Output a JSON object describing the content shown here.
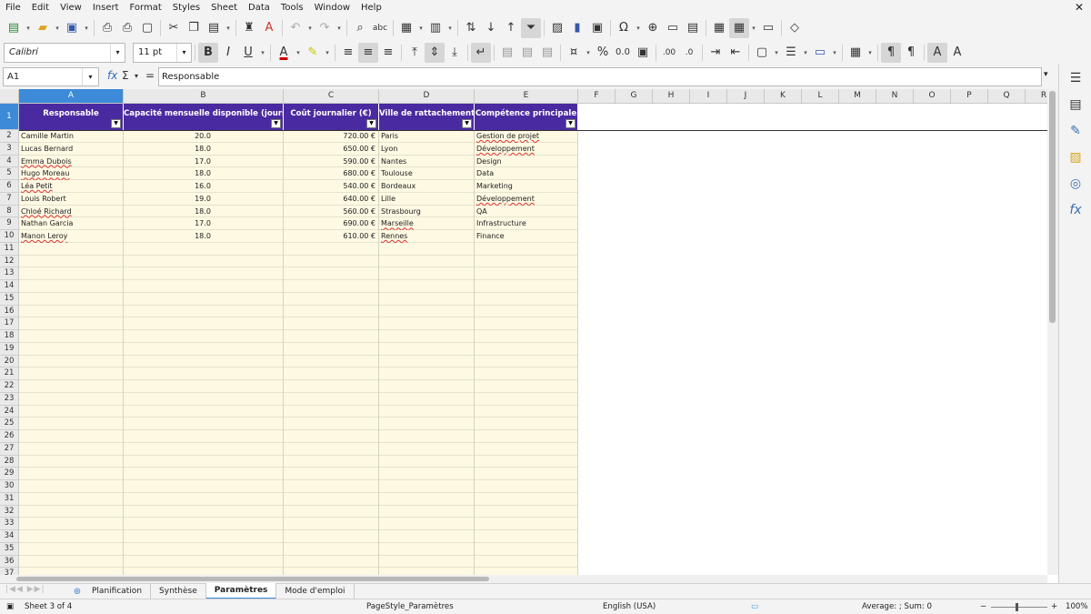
{
  "menu": [
    "File",
    "Edit",
    "View",
    "Insert",
    "Format",
    "Styles",
    "Sheet",
    "Data",
    "Tools",
    "Window",
    "Help"
  ],
  "toolbar": {
    "font_name": "Calibri",
    "font_size": "11 pt"
  },
  "formula_bar": {
    "cell_ref": "A1",
    "content": "Responsable"
  },
  "columns": [
    "A",
    "B",
    "C",
    "D",
    "E",
    "F",
    "G",
    "H",
    "I",
    "J",
    "K",
    "L",
    "M",
    "N",
    "O",
    "P",
    "Q",
    "R"
  ],
  "headers": [
    "Responsable",
    "Capacité mensuelle disponible (jours)",
    "Coût journalier (€)",
    "Ville de rattachement",
    "Compétence principale"
  ],
  "rows": [
    {
      "name": "Camille Martin",
      "capacity": "20.0",
      "cost": "720.00 €",
      "city": "Paris",
      "skill": "Gestion de projet"
    },
    {
      "name": "Lucas Bernard",
      "capacity": "18.0",
      "cost": "650.00 €",
      "city": "Lyon",
      "skill": "Développement"
    },
    {
      "name": "Emma Dubois",
      "capacity": "17.0",
      "cost": "590.00 €",
      "city": "Nantes",
      "skill": "Design"
    },
    {
      "name": "Hugo Moreau",
      "capacity": "18.0",
      "cost": "680.00 €",
      "city": "Toulouse",
      "skill": "Data"
    },
    {
      "name": "Léa Petit",
      "capacity": "16.0",
      "cost": "540.00 €",
      "city": "Bordeaux",
      "skill": "Marketing"
    },
    {
      "name": "Louis Robert",
      "capacity": "19.0",
      "cost": "640.00 €",
      "city": "Lille",
      "skill": "Développement"
    },
    {
      "name": "Chloé Richard",
      "capacity": "18.0",
      "cost": "560.00 €",
      "city": "Strasbourg",
      "skill": "QA"
    },
    {
      "name": "Nathan Garcia",
      "capacity": "17.0",
      "cost": "690.00 €",
      "city": "Marseille",
      "skill": "Infrastructure"
    },
    {
      "name": "Manon Leroy",
      "capacity": "18.0",
      "cost": "610.00 €",
      "city": "Rennes",
      "skill": "Finance"
    }
  ],
  "row_numbers": [
    "1",
    "2",
    "3",
    "4",
    "5",
    "6",
    "7",
    "8",
    "9",
    "10",
    "11",
    "12",
    "13",
    "14",
    "15",
    "16",
    "17",
    "18",
    "19",
    "20",
    "21",
    "22",
    "23",
    "24",
    "25",
    "26",
    "27",
    "28",
    "29",
    "30",
    "31",
    "32",
    "33",
    "34",
    "35",
    "36",
    "37"
  ],
  "sheet_tabs": [
    "Planification",
    "Synthèse",
    "Paramètres",
    "Mode d'emploi"
  ],
  "active_tab": "Paramètres",
  "status": {
    "sheet": "Sheet 3 of 4",
    "page_style": "PageStyle_Paramètres",
    "language": "English (USA)",
    "sum": "Average: ; Sum: 0",
    "zoom": "100%"
  },
  "colors": {
    "header_bg": "#4a2aa0",
    "band_bg": "#fdf9e3",
    "selection": "#3c8ad8"
  }
}
